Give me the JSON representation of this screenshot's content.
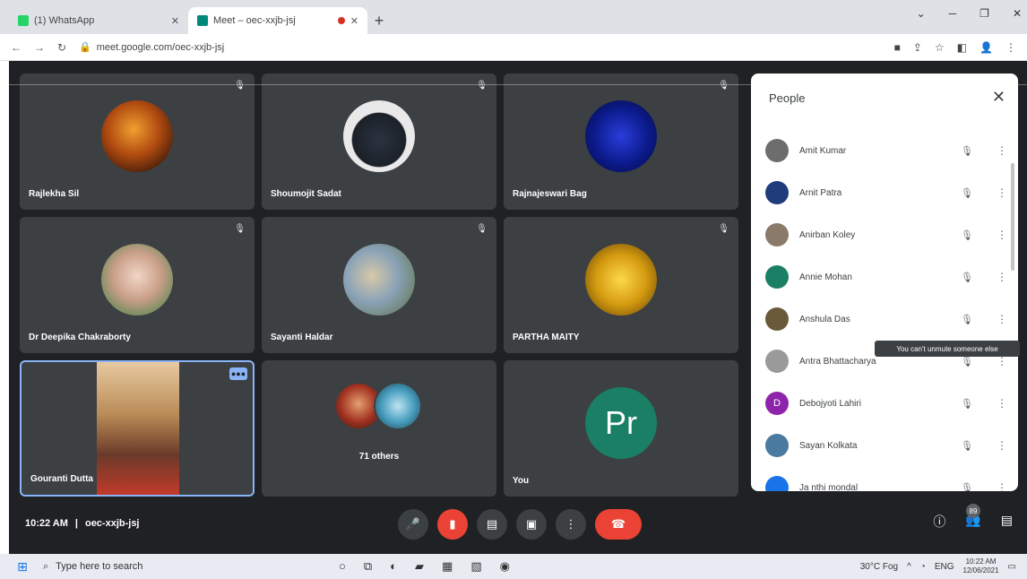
{
  "browser": {
    "tabs": [
      {
        "title": "(1) WhatsApp",
        "favicon_color": "#25d366"
      },
      {
        "title": "Meet – oec-xxjb-jsj",
        "favicon_color": "#00897b"
      }
    ],
    "url": "meet.google.com/oec-xxjb-jsj"
  },
  "meet": {
    "tiles": [
      {
        "name": "Rajlekha Sil"
      },
      {
        "name": "Shoumojit Sadat"
      },
      {
        "name": "Rajnajeswari Bag"
      },
      {
        "name": "Dr Deepika Chakraborty"
      },
      {
        "name": "Sayanti Haldar"
      },
      {
        "name": "PARTHA MAITY"
      },
      {
        "name": "Gouranti Dutta"
      },
      {
        "name": "You",
        "initials": "Pr"
      }
    ],
    "others_label": "71 others",
    "time": "10:22 AM",
    "separator": "|",
    "meeting_code": "oec-xxjb-jsj",
    "participant_count": "89"
  },
  "people_panel": {
    "title": "People",
    "people": [
      {
        "name": "Amit Kumar",
        "color": "#6d6d6d"
      },
      {
        "name": "Arnit Patra",
        "color": "#1f3d7a"
      },
      {
        "name": "Anirban Koley",
        "color": "#8a7a6a"
      },
      {
        "name": "Annie Mohan",
        "color": "#1a7f64"
      },
      {
        "name": "Anshula Das",
        "color": "#6a5a3a"
      },
      {
        "name": "Antra Bhattacharya",
        "color": "#9a9a9a"
      },
      {
        "name": "Debojyoti Lahiri",
        "color": "#8e24aa"
      },
      {
        "name": "Sayan Kolkata",
        "color": "#4a7aa0"
      },
      {
        "name": "Ja nthi mondal",
        "color": "#1a73e8"
      }
    ],
    "tooltip": "You can't unmute someone else"
  },
  "taskbar": {
    "search_placeholder": "Type here to search",
    "weather": "30°C Fog",
    "lang": "ENG",
    "clock_time": "10:22 AM",
    "clock_date": "12/06/2021"
  }
}
